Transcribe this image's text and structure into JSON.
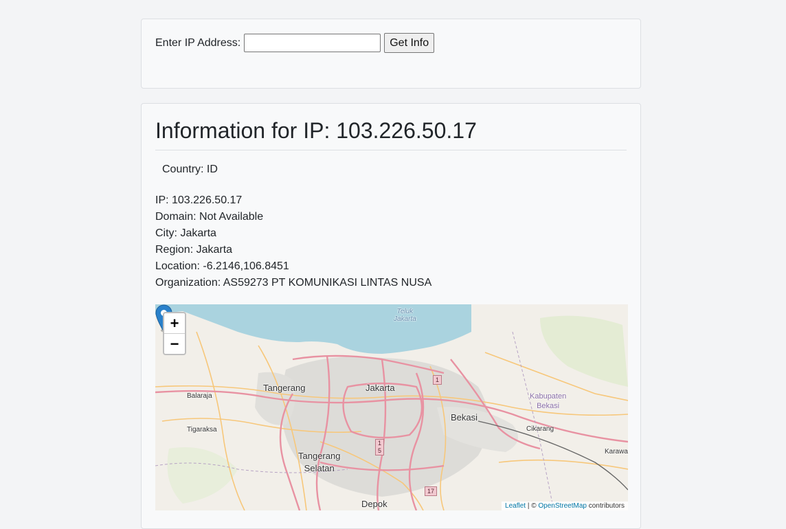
{
  "search": {
    "label": "Enter IP Address:",
    "input_value": "",
    "button_label": "Get Info"
  },
  "info": {
    "title": "Information for IP: 103.226.50.17",
    "country": "Country: ID",
    "details": [
      "IP: 103.226.50.17",
      "Domain: Not Available",
      "City: Jakarta",
      "Region: Jakarta",
      "Location: -6.2146,106.8451",
      "Organization: AS59273 PT KOMUNIKASI LINTAS NUSA"
    ]
  },
  "map": {
    "zoom_in": "+",
    "zoom_out": "−",
    "water_label_line1": "Teluk",
    "water_label_line2": "Jakarta",
    "labels": {
      "tangerang": "Tangerang",
      "jakarta": "Jakarta",
      "bekasi": "Bekasi",
      "balaraja": "Balaraja",
      "tigaraksa": "Tigaraksa",
      "tangerang_selatan_1": "Tangerang",
      "tangerang_selatan_2": "Selatan",
      "depok": "Depok",
      "kabupaten_1": "Kabupaten",
      "kabupaten_2": "Bekasi",
      "cikarang": "Cikarang",
      "karawang": "Karawa"
    },
    "road_shields": {
      "r1": "1",
      "r15a": "1",
      "r15b": "5",
      "r17": "17"
    },
    "attribution": {
      "leaflet": "Leaflet",
      "separator": " | © ",
      "osm": "OpenStreetMap",
      "suffix": " contributors"
    },
    "colors": {
      "water": "#aad3df",
      "land": "#f2efe9",
      "major_road": "#e892a2",
      "secondary_road": "#f7c77a",
      "marker": "#2a81cb"
    }
  }
}
